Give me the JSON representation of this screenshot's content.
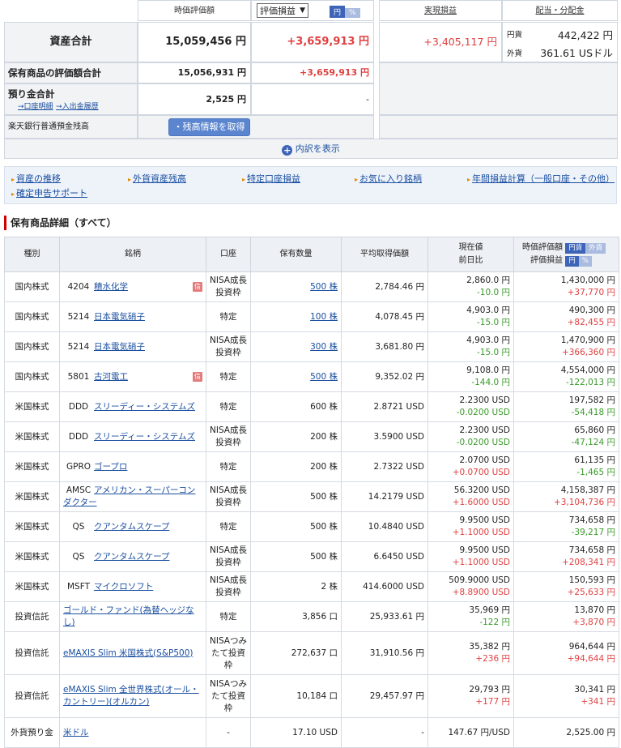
{
  "summary": {
    "col_headers": {
      "valuation": "時価評価額",
      "realized": "実現損益",
      "dividend": "配当・分配金"
    },
    "select_value": "評価損益",
    "toggle": {
      "yen": "円",
      "pct": "%"
    },
    "total": {
      "label": "資産合計",
      "value": "15,059,456 円",
      "gain": "+3,659,913 円"
    },
    "realized_value": "+3,405,117 円",
    "dividend": {
      "yen_label": "円貨",
      "yen_value": "442,422 円",
      "fx_label": "外貨",
      "fx_value": "361.61 USドル"
    },
    "holdings_total": {
      "label": "保有商品の評価額合計",
      "value": "15,056,931 円",
      "gain": "+3,659,913 円"
    },
    "deposit": {
      "label": "預り金合計",
      "link1": "→口座明細",
      "link2": "→入出金履歴",
      "value": "2,525 円",
      "gain": "-"
    },
    "bank": {
      "label": "楽天銀行普通預金残高",
      "button": "・残高情報を取得"
    },
    "expand_label": "内訳を表示"
  },
  "nav": {
    "items": [
      "資産の推移",
      "外貨資産残高",
      "特定口座損益",
      "お気に入り銘柄",
      "年間損益計算（一般口座・その他）",
      "確定申告サポート"
    ]
  },
  "section_title": "保有商品詳細（すべて）",
  "table": {
    "headers": {
      "type": "種別",
      "name": "銘柄",
      "account": "口座",
      "qty": "保有数量",
      "avg": "平均取得価額",
      "price_1": "現在値",
      "price_2": "前日比",
      "val_1": "時価評価額",
      "val_2": "評価損益",
      "toggle_yen": "円貨",
      "toggle_fx": "外貨",
      "toggle_en": "円",
      "toggle_pct": "%"
    },
    "rows": [
      {
        "type": "国内株式",
        "code": "4204",
        "name": "積水化学",
        "badge": "信",
        "account": "NISA成長投資枠",
        "qty": "500 株",
        "qty_link": true,
        "avg": "2,784.46 円",
        "price": "2,860.0 円",
        "diff": "-10.0 円",
        "value": "1,430,000 円",
        "gain": "+37,770 円"
      },
      {
        "type": "国内株式",
        "code": "5214",
        "name": "日本電気硝子",
        "badge": "",
        "account": "特定",
        "qty": "100 株",
        "qty_link": true,
        "avg": "4,078.45 円",
        "price": "4,903.0 円",
        "diff": "-15.0 円",
        "value": "490,300 円",
        "gain": "+82,455 円"
      },
      {
        "type": "国内株式",
        "code": "5214",
        "name": "日本電気硝子",
        "badge": "",
        "account": "NISA成長投資枠",
        "qty": "300 株",
        "qty_link": true,
        "avg": "3,681.80 円",
        "price": "4,903.0 円",
        "diff": "-15.0 円",
        "value": "1,470,900 円",
        "gain": "+366,360 円"
      },
      {
        "type": "国内株式",
        "code": "5801",
        "name": "古河電工",
        "badge": "信",
        "account": "特定",
        "qty": "500 株",
        "qty_link": true,
        "avg": "9,352.02 円",
        "price": "9,108.0 円",
        "diff": "-144.0 円",
        "value": "4,554,000 円",
        "gain": "-122,013 円"
      },
      {
        "type": "米国株式",
        "code": "DDD",
        "name": "スリーディー・システムズ",
        "badge": "",
        "account": "特定",
        "qty": "600 株",
        "qty_link": false,
        "avg": "2.8721 USD",
        "price": "2.2300 USD",
        "diff": "-0.0200 USD",
        "value": "197,582 円",
        "gain": "-54,418 円"
      },
      {
        "type": "米国株式",
        "code": "DDD",
        "name": "スリーディー・システムズ",
        "badge": "",
        "account": "NISA成長投資枠",
        "qty": "200 株",
        "qty_link": false,
        "avg": "3.5900 USD",
        "price": "2.2300 USD",
        "diff": "-0.0200 USD",
        "value": "65,860 円",
        "gain": "-47,124 円"
      },
      {
        "type": "米国株式",
        "code": "GPRO",
        "name": "ゴープロ",
        "badge": "",
        "account": "特定",
        "qty": "200 株",
        "qty_link": false,
        "avg": "2.7322 USD",
        "price": "2.0700 USD",
        "diff": "+0.0700 USD",
        "value": "61,135 円",
        "gain": "-1,465 円"
      },
      {
        "type": "米国株式",
        "code": "AMSC",
        "name": "アメリカン・スーパーコンダクター",
        "badge": "",
        "account": "NISA成長投資枠",
        "qty": "500 株",
        "qty_link": false,
        "avg": "14.2179 USD",
        "price": "56.3200 USD",
        "diff": "+1.6000 USD",
        "value": "4,158,387 円",
        "gain": "+3,104,736 円"
      },
      {
        "type": "米国株式",
        "code": "QS",
        "name": "クアンタムスケープ",
        "badge": "",
        "account": "特定",
        "qty": "500 株",
        "qty_link": false,
        "avg": "10.4840 USD",
        "price": "9.9500 USD",
        "diff": "+1.1000 USD",
        "value": "734,658 円",
        "gain": "-39,217 円"
      },
      {
        "type": "米国株式",
        "code": "QS",
        "name": "クアンタムスケープ",
        "badge": "",
        "account": "NISA成長投資枠",
        "qty": "500 株",
        "qty_link": false,
        "avg": "6.6450 USD",
        "price": "9.9500 USD",
        "diff": "+1.1000 USD",
        "value": "734,658 円",
        "gain": "+208,341 円"
      },
      {
        "type": "米国株式",
        "code": "MSFT",
        "name": "マイクロソフト",
        "badge": "",
        "account": "NISA成長投資枠",
        "qty": "2 株",
        "qty_link": false,
        "avg": "414.6000 USD",
        "price": "509.9000 USD",
        "diff": "+8.8900 USD",
        "value": "150,593 円",
        "gain": "+25,633 円"
      },
      {
        "type": "投資信託",
        "code": "",
        "name": "ゴールド・ファンド(為替ヘッジなし)",
        "badge": "",
        "account": "特定",
        "qty": "3,856 口",
        "qty_link": false,
        "avg": "25,933.61 円",
        "price": "35,969 円",
        "diff": "-122 円",
        "value": "13,870 円",
        "gain": "+3,870 円"
      },
      {
        "type": "投資信託",
        "code": "",
        "name": "eMAXIS Slim 米国株式(S&P500)",
        "badge": "",
        "account": "NISAつみたて投資枠",
        "qty": "272,637 口",
        "qty_link": false,
        "avg": "31,910.56 円",
        "price": "35,382 円",
        "diff": "+236 円",
        "value": "964,644 円",
        "gain": "+94,644 円"
      },
      {
        "type": "投資信託",
        "code": "",
        "name": "eMAXIS Slim 全世界株式(オール・カントリー)(オルカン)",
        "badge": "",
        "account": "NISAつみたて投資枠",
        "qty": "10,184 口",
        "qty_link": false,
        "avg": "29,457.97 円",
        "price": "29,793 円",
        "diff": "+177 円",
        "value": "30,341 円",
        "gain": "+341 円"
      },
      {
        "type": "外貨預り金",
        "code": "",
        "name": "米ドル",
        "badge": "",
        "account": "-",
        "qty": "17.10 USD",
        "qty_link": false,
        "avg": "-",
        "price": "147.67 円/USD",
        "diff": "",
        "value": "2,525.00 円",
        "gain": ""
      }
    ]
  },
  "colors": {
    "accent": "#3d64b8",
    "positive": "#e04040",
    "negative": "#3a9a2a",
    "section_bar": "#cc0000"
  }
}
